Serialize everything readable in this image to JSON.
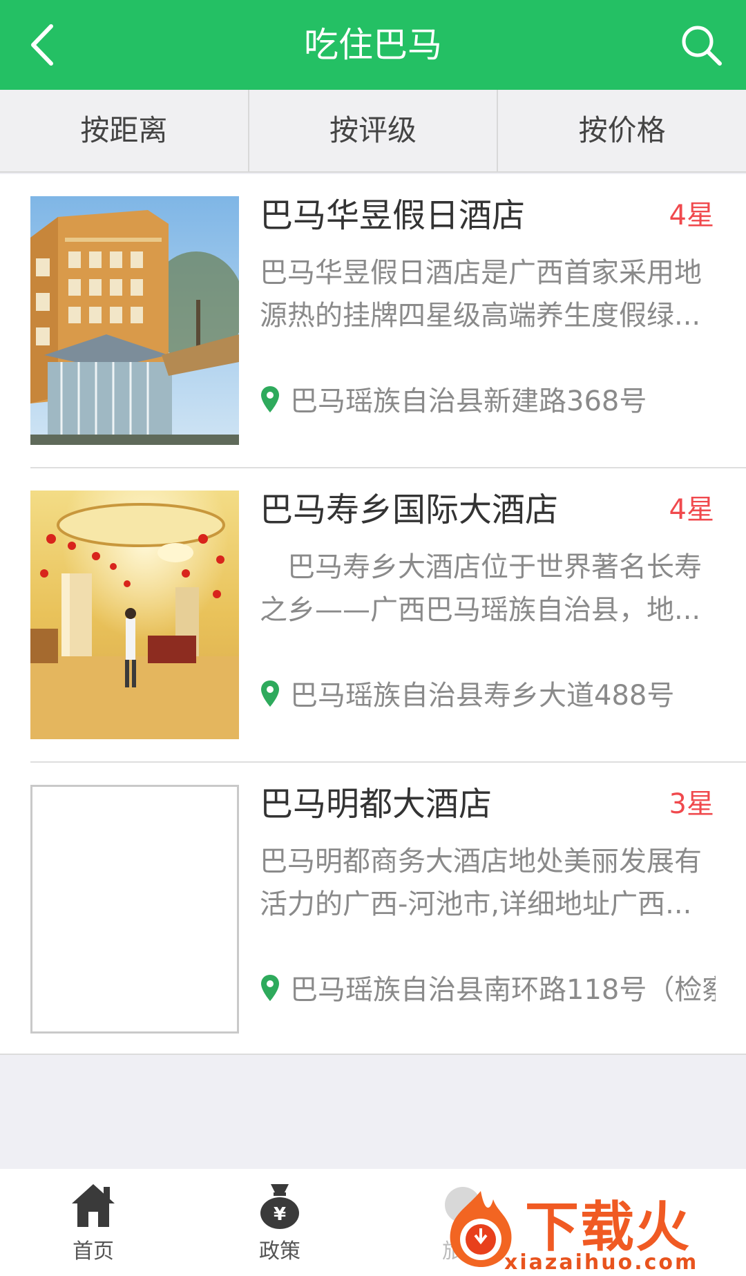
{
  "header": {
    "title": "吃住巴马",
    "back_icon": "back-arrow-icon",
    "search_icon": "search-icon",
    "bg_color": "#24c064"
  },
  "sort_tabs": [
    {
      "label": "按距离"
    },
    {
      "label": "按评级"
    },
    {
      "label": "按价格"
    }
  ],
  "hotels": [
    {
      "name": "巴马华昱假日酒店",
      "stars": "4星",
      "description": "巴马华昱假日酒店是广西首家采用地源热的挂牌四星级高端养生度假绿...",
      "address": "巴马瑶族自治县新建路368号",
      "image": "hotel-building-photo"
    },
    {
      "name": "巴马寿乡国际大酒店",
      "stars": "4星",
      "description": "　巴马寿乡大酒店位于世界著名长寿之乡——广西巴马瑶族自治县，地...",
      "address": "巴马瑶族自治县寿乡大道488号",
      "image": "hotel-lobby-photo"
    },
    {
      "name": "巴马明都大酒店",
      "stars": "3星",
      "description": "巴马明都商务大酒店地处美丽发展有活力的广西-河池市,详细地址广西...",
      "address": "巴马瑶族自治县南环路118号（检察",
      "image": "empty"
    }
  ],
  "tabbar": [
    {
      "label": "首页",
      "icon": "home-icon"
    },
    {
      "label": "政策",
      "icon": "money-bag-icon"
    },
    {
      "label": "旅游",
      "icon": "travel-icon"
    }
  ],
  "watermark": {
    "brand": "下载火",
    "url": "xiazaihuo.com"
  },
  "colors": {
    "accent": "#24c064",
    "star_red": "#f0494d",
    "pin_green": "#2eaa5c"
  }
}
